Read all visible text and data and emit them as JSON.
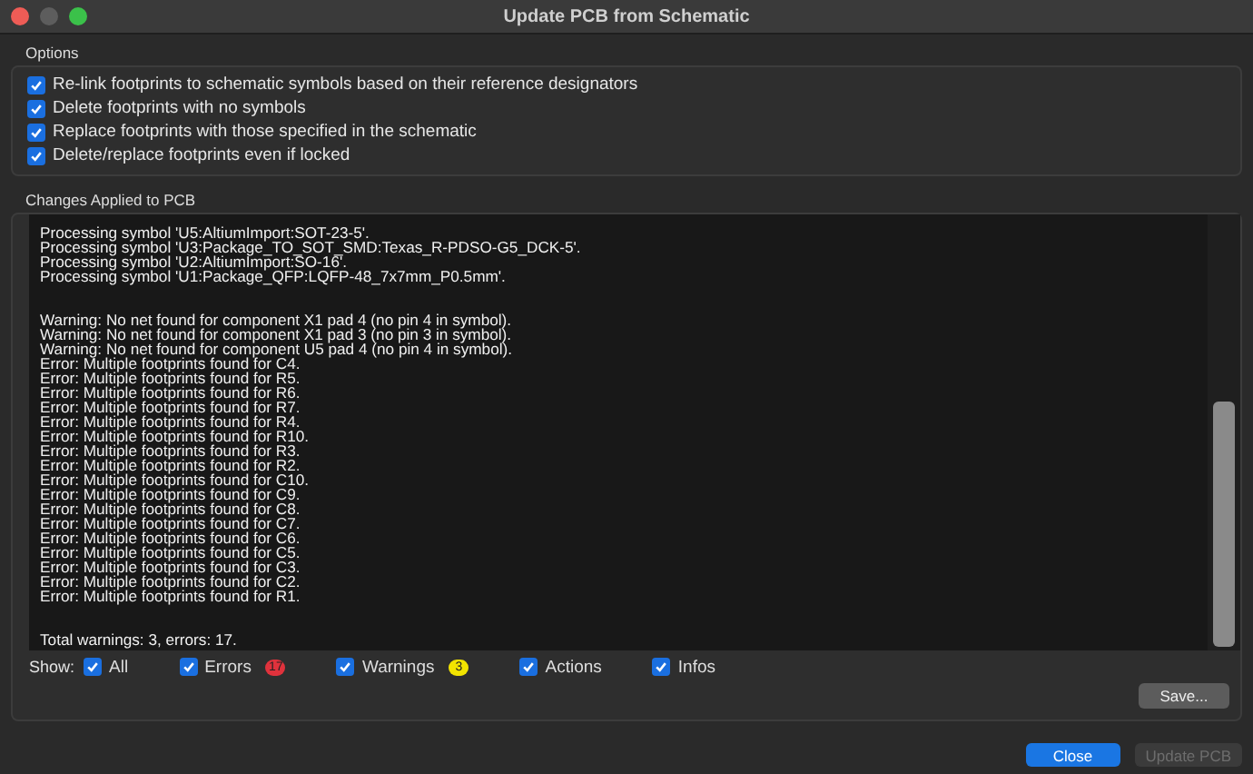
{
  "window": {
    "title": "Update PCB from Schematic"
  },
  "options": {
    "title": "Options",
    "items": [
      {
        "label": "Re-link footprints to schematic symbols based on their reference designators",
        "checked": true
      },
      {
        "label": "Delete footprints with no symbols",
        "checked": true
      },
      {
        "label": "Replace footprints with those specified in the schematic",
        "checked": true
      },
      {
        "label": "Delete/replace footprints even if locked",
        "checked": true
      }
    ]
  },
  "changes": {
    "title": "Changes Applied to PCB",
    "log_groups": [
      [
        "Processing symbol 'U5:AltiumImport:SOT-23-5'.",
        "Processing symbol 'U3:Package_TO_SOT_SMD:Texas_R-PDSO-G5_DCK-5'.",
        "Processing symbol 'U2:AltiumImport:SO-16'.",
        "Processing symbol 'U1:Package_QFP:LQFP-48_7x7mm_P0.5mm'."
      ],
      [
        "Warning: No net found for component X1 pad 4 (no pin 4 in symbol).",
        "Warning: No net found for component X1 pad 3 (no pin 3 in symbol).",
        "Warning: No net found for component U5 pad 4 (no pin 4 in symbol).",
        "Error: Multiple footprints found for C4.",
        "Error: Multiple footprints found for R5.",
        "Error: Multiple footprints found for R6.",
        "Error: Multiple footprints found for R7.",
        "Error: Multiple footprints found for R4.",
        "Error: Multiple footprints found for R10.",
        "Error: Multiple footprints found for R3.",
        "Error: Multiple footprints found for R2.",
        "Error: Multiple footprints found for C10.",
        "Error: Multiple footprints found for C9.",
        "Error: Multiple footprints found for C8.",
        "Error: Multiple footprints found for C7.",
        "Error: Multiple footprints found for C6.",
        "Error: Multiple footprints found for C5.",
        "Error: Multiple footprints found for C3.",
        "Error: Multiple footprints found for C2.",
        "Error: Multiple footprints found for R1."
      ],
      [
        "Total warnings: 3, errors: 17."
      ]
    ]
  },
  "filters": {
    "label": "Show:",
    "items": [
      {
        "label": "All",
        "checked": true
      },
      {
        "label": "Errors",
        "checked": true,
        "badge": "17",
        "color": "#e0323c"
      },
      {
        "label": "Warnings",
        "checked": true,
        "badge": "3",
        "color": "#f2e400"
      },
      {
        "label": "Actions",
        "checked": true
      },
      {
        "label": "Infos",
        "checked": true
      }
    ]
  },
  "save_button": "Save...",
  "buttons": [
    {
      "label": "Close",
      "kind": "primary",
      "disabled": false
    },
    {
      "label": "Update PCB",
      "kind": "normal",
      "disabled": true
    }
  ]
}
